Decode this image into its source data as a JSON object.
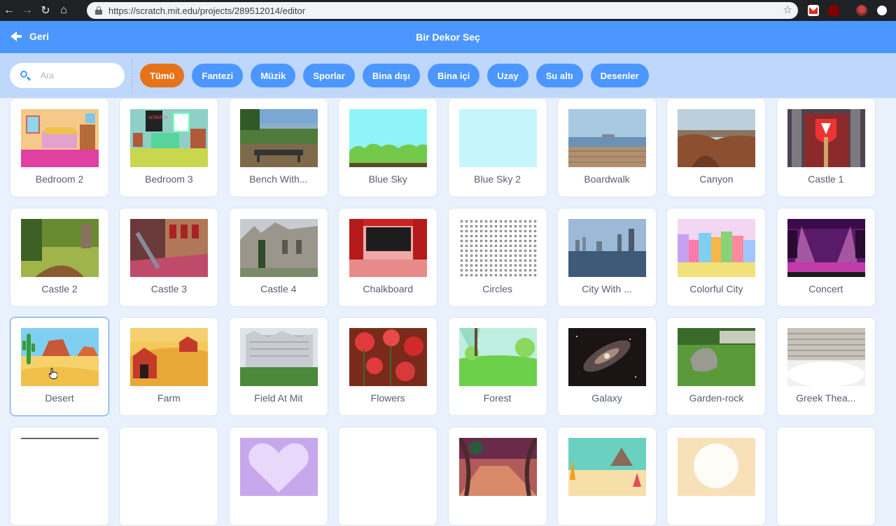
{
  "browser": {
    "url": "https://scratch.mit.edu/projects/289512014/editor",
    "icons": [
      "back-icon",
      "forward-icon",
      "reload-icon",
      "home-icon",
      "star-icon",
      "gmail-icon",
      "ublock-icon",
      "profile-avatar"
    ]
  },
  "header": {
    "back_label": "Geri",
    "title": "Bir Dekor Seç"
  },
  "search": {
    "placeholder": "Ara",
    "value": ""
  },
  "tags": [
    {
      "label": "Tümü",
      "active": true
    },
    {
      "label": "Fantezi",
      "active": false
    },
    {
      "label": "Müzik",
      "active": false
    },
    {
      "label": "Sporlar",
      "active": false
    },
    {
      "label": "Bina dışı",
      "active": false
    },
    {
      "label": "Bina içi",
      "active": false
    },
    {
      "label": "Uzay",
      "active": false
    },
    {
      "label": "Su altı",
      "active": false
    },
    {
      "label": "Desenler",
      "active": false
    }
  ],
  "backdrops": [
    {
      "name": "Bedroom 2"
    },
    {
      "name": "Bedroom 3"
    },
    {
      "name": "Bench With..."
    },
    {
      "name": "Blue Sky"
    },
    {
      "name": "Blue Sky 2"
    },
    {
      "name": "Boardwalk"
    },
    {
      "name": "Canyon"
    },
    {
      "name": "Castle 1"
    },
    {
      "name": "Castle 2"
    },
    {
      "name": "Castle 3"
    },
    {
      "name": "Castle 4"
    },
    {
      "name": "Chalkboard"
    },
    {
      "name": "Circles"
    },
    {
      "name": "City With ..."
    },
    {
      "name": "Colorful City"
    },
    {
      "name": "Concert"
    },
    {
      "name": "Desert",
      "selected": true
    },
    {
      "name": "Farm"
    },
    {
      "name": "Field At Mit"
    },
    {
      "name": "Flowers"
    },
    {
      "name": "Forest"
    },
    {
      "name": "Galaxy"
    },
    {
      "name": "Garden-rock"
    },
    {
      "name": "Greek Thea..."
    },
    {
      "name": ""
    },
    {
      "name": ""
    },
    {
      "name": ""
    },
    {
      "name": ""
    },
    {
      "name": ""
    },
    {
      "name": ""
    },
    {
      "name": ""
    },
    {
      "name": ""
    }
  ],
  "colors": {
    "header": "#4c97ff",
    "filter_bar": "#bfd7fb",
    "active_tag": "#e6731a",
    "background": "#e9f1fc"
  }
}
